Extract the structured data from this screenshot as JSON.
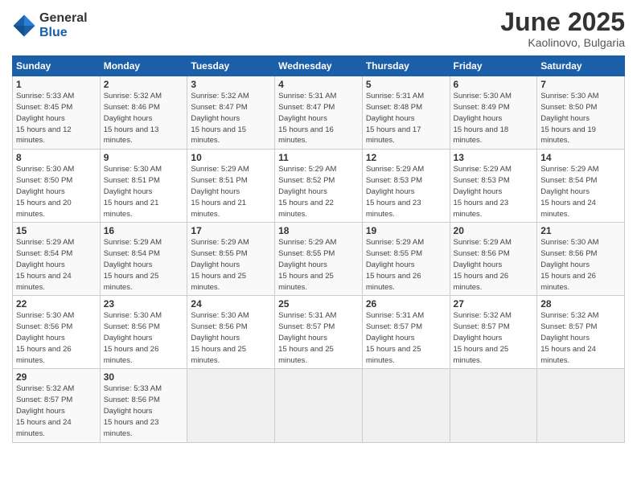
{
  "header": {
    "logo_general": "General",
    "logo_blue": "Blue",
    "month": "June 2025",
    "location": "Kaolinovo, Bulgaria"
  },
  "days_of_week": [
    "Sunday",
    "Monday",
    "Tuesday",
    "Wednesday",
    "Thursday",
    "Friday",
    "Saturday"
  ],
  "weeks": [
    [
      {
        "day": 1,
        "sunrise": "5:33 AM",
        "sunset": "8:45 PM",
        "daylight": "15 hours and 12 minutes."
      },
      {
        "day": 2,
        "sunrise": "5:32 AM",
        "sunset": "8:46 PM",
        "daylight": "15 hours and 13 minutes."
      },
      {
        "day": 3,
        "sunrise": "5:32 AM",
        "sunset": "8:47 PM",
        "daylight": "15 hours and 15 minutes."
      },
      {
        "day": 4,
        "sunrise": "5:31 AM",
        "sunset": "8:47 PM",
        "daylight": "15 hours and 16 minutes."
      },
      {
        "day": 5,
        "sunrise": "5:31 AM",
        "sunset": "8:48 PM",
        "daylight": "15 hours and 17 minutes."
      },
      {
        "day": 6,
        "sunrise": "5:30 AM",
        "sunset": "8:49 PM",
        "daylight": "15 hours and 18 minutes."
      },
      {
        "day": 7,
        "sunrise": "5:30 AM",
        "sunset": "8:50 PM",
        "daylight": "15 hours and 19 minutes."
      }
    ],
    [
      {
        "day": 8,
        "sunrise": "5:30 AM",
        "sunset": "8:50 PM",
        "daylight": "15 hours and 20 minutes."
      },
      {
        "day": 9,
        "sunrise": "5:30 AM",
        "sunset": "8:51 PM",
        "daylight": "15 hours and 21 minutes."
      },
      {
        "day": 10,
        "sunrise": "5:29 AM",
        "sunset": "8:51 PM",
        "daylight": "15 hours and 21 minutes."
      },
      {
        "day": 11,
        "sunrise": "5:29 AM",
        "sunset": "8:52 PM",
        "daylight": "15 hours and 22 minutes."
      },
      {
        "day": 12,
        "sunrise": "5:29 AM",
        "sunset": "8:53 PM",
        "daylight": "15 hours and 23 minutes."
      },
      {
        "day": 13,
        "sunrise": "5:29 AM",
        "sunset": "8:53 PM",
        "daylight": "15 hours and 23 minutes."
      },
      {
        "day": 14,
        "sunrise": "5:29 AM",
        "sunset": "8:54 PM",
        "daylight": "15 hours and 24 minutes."
      }
    ],
    [
      {
        "day": 15,
        "sunrise": "5:29 AM",
        "sunset": "8:54 PM",
        "daylight": "15 hours and 24 minutes."
      },
      {
        "day": 16,
        "sunrise": "5:29 AM",
        "sunset": "8:54 PM",
        "daylight": "15 hours and 25 minutes."
      },
      {
        "day": 17,
        "sunrise": "5:29 AM",
        "sunset": "8:55 PM",
        "daylight": "15 hours and 25 minutes."
      },
      {
        "day": 18,
        "sunrise": "5:29 AM",
        "sunset": "8:55 PM",
        "daylight": "15 hours and 25 minutes."
      },
      {
        "day": 19,
        "sunrise": "5:29 AM",
        "sunset": "8:55 PM",
        "daylight": "15 hours and 26 minutes."
      },
      {
        "day": 20,
        "sunrise": "5:29 AM",
        "sunset": "8:56 PM",
        "daylight": "15 hours and 26 minutes."
      },
      {
        "day": 21,
        "sunrise": "5:30 AM",
        "sunset": "8:56 PM",
        "daylight": "15 hours and 26 minutes."
      }
    ],
    [
      {
        "day": 22,
        "sunrise": "5:30 AM",
        "sunset": "8:56 PM",
        "daylight": "15 hours and 26 minutes."
      },
      {
        "day": 23,
        "sunrise": "5:30 AM",
        "sunset": "8:56 PM",
        "daylight": "15 hours and 26 minutes."
      },
      {
        "day": 24,
        "sunrise": "5:30 AM",
        "sunset": "8:56 PM",
        "daylight": "15 hours and 25 minutes."
      },
      {
        "day": 25,
        "sunrise": "5:31 AM",
        "sunset": "8:57 PM",
        "daylight": "15 hours and 25 minutes."
      },
      {
        "day": 26,
        "sunrise": "5:31 AM",
        "sunset": "8:57 PM",
        "daylight": "15 hours and 25 minutes."
      },
      {
        "day": 27,
        "sunrise": "5:32 AM",
        "sunset": "8:57 PM",
        "daylight": "15 hours and 25 minutes."
      },
      {
        "day": 28,
        "sunrise": "5:32 AM",
        "sunset": "8:57 PM",
        "daylight": "15 hours and 24 minutes."
      }
    ],
    [
      {
        "day": 29,
        "sunrise": "5:32 AM",
        "sunset": "8:57 PM",
        "daylight": "15 hours and 24 minutes."
      },
      {
        "day": 30,
        "sunrise": "5:33 AM",
        "sunset": "8:56 PM",
        "daylight": "15 hours and 23 minutes."
      },
      null,
      null,
      null,
      null,
      null
    ]
  ]
}
